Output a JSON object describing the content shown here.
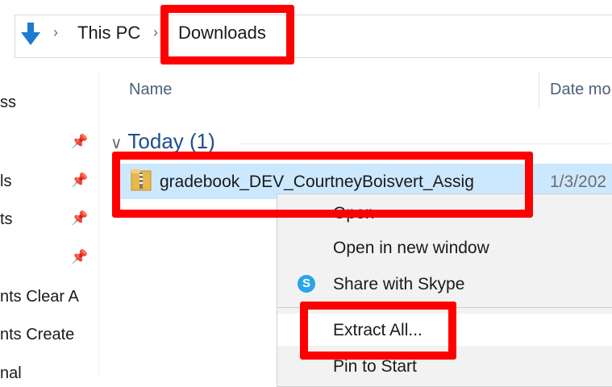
{
  "address_bar": {
    "breadcrumb": [
      "This PC",
      "Downloads"
    ]
  },
  "nav_pane": {
    "items": [
      "ss",
      "ls",
      "ts",
      "nts Clear A",
      "nts Create",
      "nal"
    ]
  },
  "file_list": {
    "columns": [
      "Name",
      "Date mo"
    ],
    "group": {
      "label": "Today (1)"
    },
    "rows": [
      {
        "name": "gradebook_DEV_CourtneyBoisvert_Assig",
        "date": "1/3/202"
      }
    ]
  },
  "context_menu": {
    "items": [
      "Open",
      "Open in new window",
      "Share with Skype",
      "Extract All...",
      "Pin to Start"
    ]
  },
  "colors": {
    "annotation": "#ff0000",
    "selection": "#cce8ff",
    "group_header": "#1e4e8c"
  }
}
